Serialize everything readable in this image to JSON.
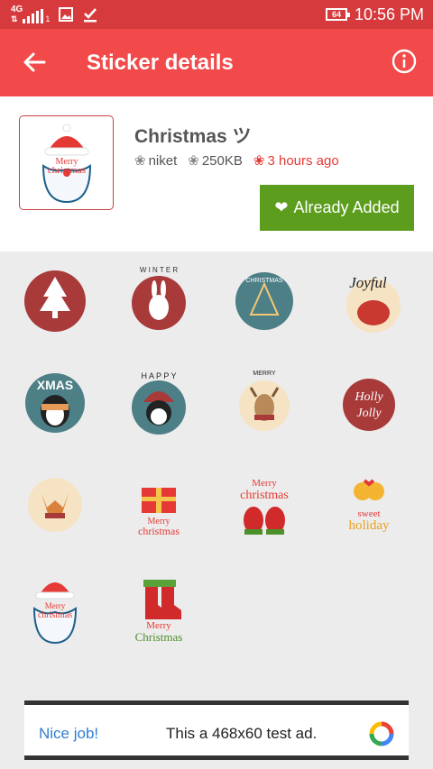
{
  "status_bar": {
    "network": "4G",
    "sim_slot": "1",
    "battery": "64",
    "time": "10:56 PM"
  },
  "app_bar": {
    "title": "Sticker details",
    "back_icon": "arrow-back-icon",
    "info_icon": "info-icon"
  },
  "pack": {
    "name": "Christmas ツ",
    "author": "niket",
    "size": "250KB",
    "updated": "3 hours ago",
    "button_label": "Already Added"
  },
  "stickers": [
    {
      "name": "sticker-christmas-tree",
      "text": ""
    },
    {
      "name": "sticker-winter-bunny",
      "text": "WINTER"
    },
    {
      "name": "sticker-christmas-tree-circle",
      "text": "CHRISTMAS"
    },
    {
      "name": "sticker-joyful-hedgehog",
      "text": "Joyful"
    },
    {
      "name": "sticker-xmas-penguin",
      "text": "XMAS"
    },
    {
      "name": "sticker-happy-holly-penguin",
      "text": "HAPPY"
    },
    {
      "name": "sticker-merry-christmas-reindeer",
      "text": "MERRY"
    },
    {
      "name": "sticker-holly-jolly",
      "text": "Holly Jolly"
    },
    {
      "name": "sticker-fox",
      "text": ""
    },
    {
      "name": "sticker-gift-merry-christmas",
      "text": "Merry christmas"
    },
    {
      "name": "sticker-mittens-merry-christmas",
      "text": "Merry christmas"
    },
    {
      "name": "sticker-sweet-holiday-bells",
      "text": "sweet holiday"
    },
    {
      "name": "sticker-santa-merry-christmas",
      "text": "Merry christmas"
    },
    {
      "name": "sticker-stockings-merry-christmas",
      "text": "Merry Christmas"
    }
  ],
  "ad": {
    "label": "Nice job!",
    "text": "This a 468x60 test ad."
  },
  "colors": {
    "status_bar": "#d63a3c",
    "app_bar": "#f24a4a",
    "added_button": "#5c9d1d",
    "accent_red": "#e53935"
  }
}
